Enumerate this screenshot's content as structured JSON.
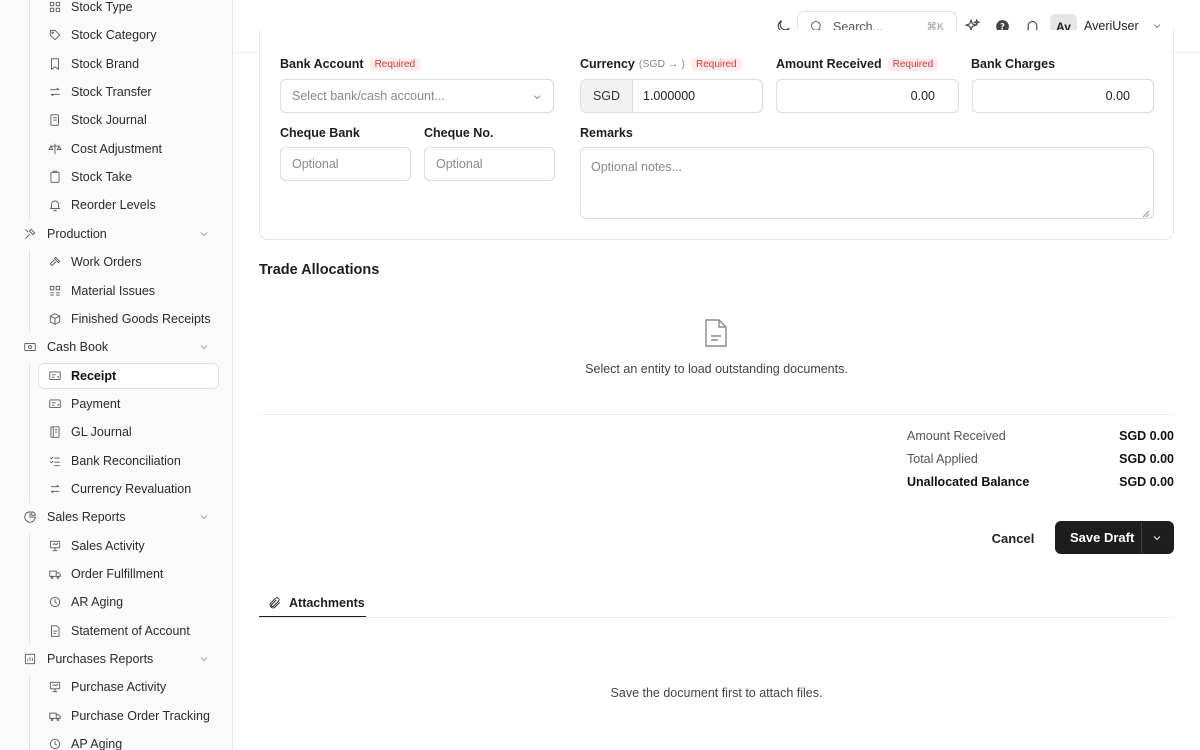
{
  "sidebar": {
    "items": [
      {
        "label": "Stock Type",
        "icon": "grid-icon",
        "kind": "child"
      },
      {
        "label": "Stock Category",
        "icon": "tag-icon",
        "kind": "child"
      },
      {
        "label": "Stock Brand",
        "icon": "bookmark-icon",
        "kind": "child"
      },
      {
        "label": "Stock Transfer",
        "icon": "arrows-swap-icon",
        "kind": "child"
      },
      {
        "label": "Stock Journal",
        "icon": "journal-icon",
        "kind": "child"
      },
      {
        "label": "Cost Adjustment",
        "icon": "scale-icon",
        "kind": "child"
      },
      {
        "label": "Stock Take",
        "icon": "clipboard-icon",
        "kind": "child"
      },
      {
        "label": "Reorder Levels",
        "icon": "bell-icon",
        "kind": "child"
      },
      {
        "label": "Production",
        "icon": "tools-icon",
        "kind": "group"
      },
      {
        "label": "Work Orders",
        "icon": "hammer-icon",
        "kind": "child"
      },
      {
        "label": "Material Issues",
        "icon": "grid-list-icon",
        "kind": "child"
      },
      {
        "label": "Finished Goods Receipts",
        "icon": "box-icon",
        "kind": "child"
      },
      {
        "label": "Cash Book",
        "icon": "cash-icon",
        "kind": "group"
      },
      {
        "label": "Receipt",
        "icon": "receipt-in-icon",
        "kind": "child",
        "active": true
      },
      {
        "label": "Payment",
        "icon": "payment-out-icon",
        "kind": "child"
      },
      {
        "label": "GL Journal",
        "icon": "ledger-icon",
        "kind": "child"
      },
      {
        "label": "Bank Reconciliation",
        "icon": "checklist-icon",
        "kind": "child"
      },
      {
        "label": "Currency Revaluation",
        "icon": "exchange-icon",
        "kind": "child"
      },
      {
        "label": "Sales Reports",
        "icon": "pie-chart-icon",
        "kind": "group"
      },
      {
        "label": "Sales Activity",
        "icon": "presentation-icon",
        "kind": "child"
      },
      {
        "label": "Order Fulfillment",
        "icon": "truck-icon",
        "kind": "child"
      },
      {
        "label": "AR Aging",
        "icon": "clock-icon",
        "kind": "child"
      },
      {
        "label": "Statement of Account",
        "icon": "document-icon",
        "kind": "child"
      },
      {
        "label": "Purchases Reports",
        "icon": "chart-box-icon",
        "kind": "group"
      },
      {
        "label": "Purchase Activity",
        "icon": "presentation-icon",
        "kind": "child"
      },
      {
        "label": "Purchase Order Tracking",
        "icon": "truck-icon",
        "kind": "child"
      },
      {
        "label": "AP Aging",
        "icon": "clock-icon",
        "kind": "child"
      }
    ]
  },
  "header": {
    "search_placeholder": "Search...",
    "search_shortcut": "⌘K",
    "avatar_initials": "Av",
    "username": "AveriUser"
  },
  "form": {
    "bank_account": {
      "label": "Bank Account",
      "required": "Required",
      "placeholder": "Select bank/cash account..."
    },
    "currency": {
      "label": "Currency",
      "hint": "(SGD → )",
      "required": "Required",
      "code": "SGD",
      "rate": "1.000000"
    },
    "amount_received": {
      "label": "Amount Received",
      "required": "Required",
      "value": "0.00"
    },
    "bank_charges": {
      "label": "Bank Charges",
      "value": "0.00"
    },
    "cheque_bank": {
      "label": "Cheque Bank",
      "placeholder": "Optional"
    },
    "cheque_no": {
      "label": "Cheque No.",
      "placeholder": "Optional"
    },
    "remarks": {
      "label": "Remarks",
      "placeholder": "Optional notes..."
    }
  },
  "allocations": {
    "title": "Trade Allocations",
    "empty_message": "Select an entity to load outstanding documents."
  },
  "summary": {
    "amount_received_label": "Amount Received",
    "amount_received_value": "SGD 0.00",
    "total_applied_label": "Total Applied",
    "total_applied_value": "SGD 0.00",
    "unallocated_label": "Unallocated Balance",
    "unallocated_value": "SGD 0.00"
  },
  "actions": {
    "cancel_label": "Cancel",
    "save_label": "Save Draft"
  },
  "attachments": {
    "tab_label": "Attachments",
    "empty_message": "Save the document first to attach files."
  },
  "colors": {
    "accent": "#1d1d1d",
    "required": "#d43a3a"
  }
}
